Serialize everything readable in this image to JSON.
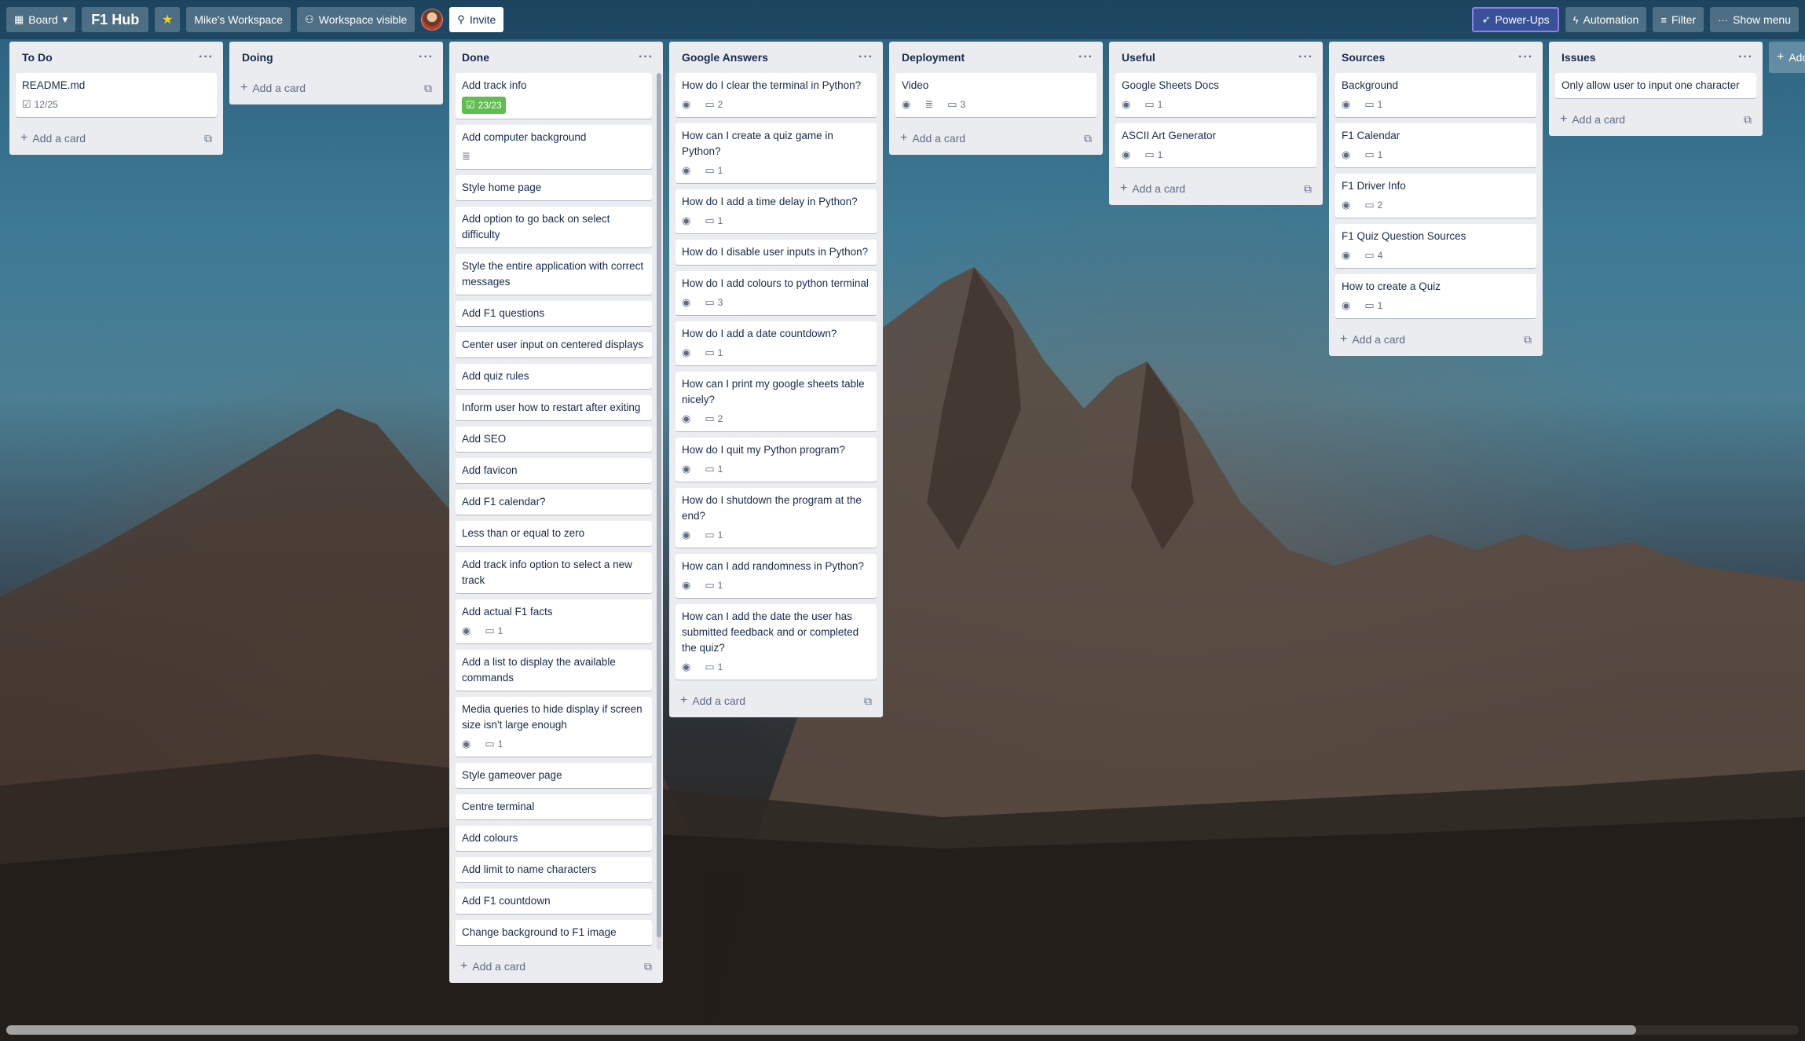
{
  "topbar": {
    "board_view_label": "Board",
    "board_title": "F1 Hub",
    "workspace_label": "Mike's Workspace",
    "visibility_label": "Workspace visible",
    "invite_label": "Invite",
    "powerups_label": "Power-Ups",
    "automation_label": "Automation",
    "filter_label": "Filter",
    "show_menu_label": "Show menu",
    "add_list_label": "Add another list"
  },
  "lists": [
    {
      "title": "To Do",
      "cards": [
        {
          "title": "README.md",
          "checklist": "12/25"
        }
      ],
      "add_label": "Add a card"
    },
    {
      "title": "Doing",
      "cards": [],
      "add_label": "Add a card"
    },
    {
      "title": "Done",
      "cards": [
        {
          "title": "Add track info",
          "checklist_done": "23/23"
        },
        {
          "title": "Add computer background",
          "description": true
        },
        {
          "title": "Style home page"
        },
        {
          "title": "Add option to go back on select difficulty"
        },
        {
          "title": "Style the entire application with correct messages"
        },
        {
          "title": "Add F1 questions"
        },
        {
          "title": "Center user input on centered displays"
        },
        {
          "title": "Add quiz rules"
        },
        {
          "title": "Inform user how to restart after exiting"
        },
        {
          "title": "Add SEO"
        },
        {
          "title": "Add favicon"
        },
        {
          "title": "Add F1 calendar?"
        },
        {
          "title": "Less than or equal to zero"
        },
        {
          "title": "Add track info option to select a new track"
        },
        {
          "title": "Add actual F1 facts",
          "watch": true,
          "comments": "1"
        },
        {
          "title": "Add a list to display the available commands"
        },
        {
          "title": "Media queries to hide display if screen size isn't large enough",
          "watch": true,
          "comments": "1"
        },
        {
          "title": "Style gameover page"
        },
        {
          "title": "Centre terminal"
        },
        {
          "title": "Add colours"
        },
        {
          "title": "Add limit to name characters"
        },
        {
          "title": "Add F1 countdown"
        },
        {
          "title": "Change background to F1 image"
        }
      ],
      "add_label": "Add a card"
    },
    {
      "title": "Google Answers",
      "cards": [
        {
          "title": "How do I clear the terminal in Python?",
          "watch": true,
          "comments": "2"
        },
        {
          "title": "How can I create a quiz game in Python?",
          "watch": true,
          "comments": "1"
        },
        {
          "title": "How do I add a time delay in Python?",
          "watch": true,
          "comments": "1"
        },
        {
          "title": "How do I disable user inputs in Python?"
        },
        {
          "title": "How do I add colours to python terminal",
          "watch": true,
          "comments": "3"
        },
        {
          "title": "How do I add a date countdown?",
          "watch": true,
          "comments": "1"
        },
        {
          "title": "How can I print my google sheets table nicely?",
          "watch": true,
          "comments": "2"
        },
        {
          "title": "How do I quit my Python program?",
          "watch": true,
          "comments": "1"
        },
        {
          "title": "How do I shutdown the program at the end?",
          "watch": true,
          "comments": "1"
        },
        {
          "title": "How can I add randomness in Python?",
          "watch": true,
          "comments": "1"
        },
        {
          "title": "How can I add the date the user has submitted feedback and or completed the quiz?",
          "watch": true,
          "comments": "1"
        }
      ],
      "add_label": "Add a card"
    },
    {
      "title": "Deployment",
      "cards": [
        {
          "title": "Video",
          "watch": true,
          "description": true,
          "comments": "3"
        }
      ],
      "add_label": "Add a card"
    },
    {
      "title": "Useful",
      "cards": [
        {
          "title": "Google Sheets Docs",
          "watch": true,
          "comments": "1"
        },
        {
          "title": "ASCII Art Generator",
          "watch": true,
          "comments": "1"
        }
      ],
      "add_label": "Add a card"
    },
    {
      "title": "Sources",
      "cards": [
        {
          "title": "Background",
          "watch": true,
          "comments": "1"
        },
        {
          "title": "F1 Calendar",
          "watch": true,
          "comments": "1"
        },
        {
          "title": "F1 Driver Info",
          "watch": true,
          "comments": "2"
        },
        {
          "title": "F1 Quiz Question Sources",
          "watch": true,
          "comments": "4"
        },
        {
          "title": "How to create a Quiz",
          "watch": true,
          "comments": "1"
        }
      ],
      "add_label": "Add a card"
    },
    {
      "title": "Issues",
      "cards": [
        {
          "title": "Only allow user to input one character"
        }
      ],
      "add_label": "Add a card"
    }
  ]
}
